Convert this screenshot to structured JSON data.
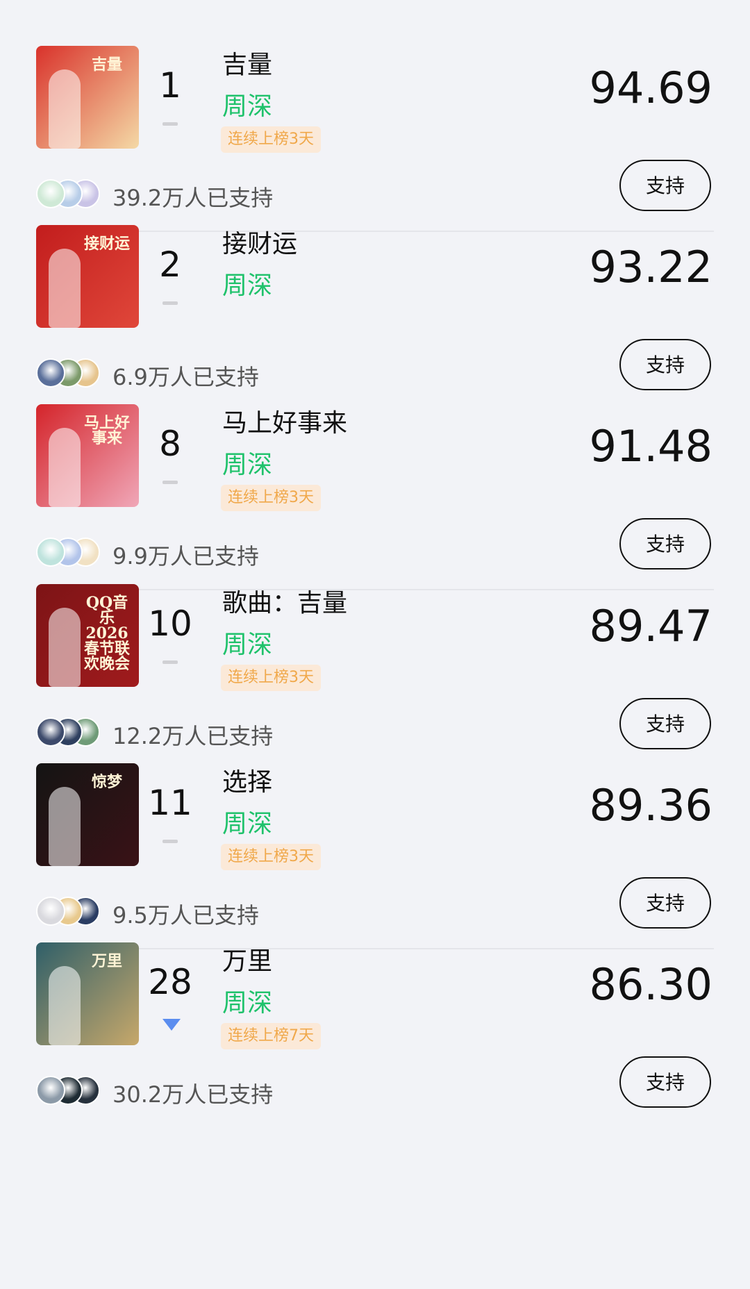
{
  "support_label": "支持",
  "entries": [
    {
      "rank": "1",
      "title": "吉量",
      "artist": "周深",
      "streak": "连续上榜3天",
      "score": "94.69",
      "supporters": "39.2万人已支持",
      "trend": "flat",
      "cover_text": "吉量",
      "cover_colors": [
        "#d9322b",
        "#f4d9a6"
      ],
      "avatar_colors": [
        "#cfe9d6",
        "#b7cde8",
        "#c9c3e6"
      ]
    },
    {
      "rank": "2",
      "title": "接财运",
      "artist": "周深",
      "streak": "",
      "score": "93.22",
      "supporters": "6.9万人已支持",
      "trend": "flat",
      "cover_text": "接财运",
      "cover_colors": [
        "#c21d1d",
        "#e0473a"
      ],
      "avatar_colors": [
        "#5a6f9a",
        "#7c9a6a",
        "#e6c48d"
      ]
    },
    {
      "rank": "8",
      "title": "马上好事来",
      "artist": "周深",
      "streak": "连续上榜3天",
      "score": "91.48",
      "supporters": "9.9万人已支持",
      "trend": "flat",
      "cover_text": "马上好事来",
      "cover_colors": [
        "#d4242a",
        "#f0a7b8"
      ],
      "avatar_colors": [
        "#bfe3dd",
        "#b2c4ea",
        "#f1e1c3"
      ]
    },
    {
      "rank": "10",
      "title": "歌曲：吉量",
      "artist": "周深",
      "streak": "连续上榜3天",
      "score": "89.47",
      "supporters": "12.2万人已支持",
      "trend": "flat",
      "cover_text": "QQ音乐 2026 春节联欢晚会",
      "cover_colors": [
        "#7d1416",
        "#a01b1d"
      ],
      "avatar_colors": [
        "#3d4a6b",
        "#2e3f5f",
        "#6f9b77"
      ]
    },
    {
      "rank": "11",
      "title": "选择",
      "artist": "周深",
      "streak": "连续上榜3天",
      "score": "89.36",
      "supporters": "9.5万人已支持",
      "trend": "flat",
      "cover_text": "惊梦",
      "cover_colors": [
        "#141414",
        "#3a1216"
      ],
      "avatar_colors": [
        "#d9d9de",
        "#e8c98d",
        "#2b3d63"
      ]
    },
    {
      "rank": "28",
      "title": "万里",
      "artist": "周深",
      "streak": "连续上榜7天",
      "score": "86.30",
      "supporters": "30.2万人已支持",
      "trend": "down",
      "cover_text": "万里",
      "cover_colors": [
        "#2f5f69",
        "#c7a86a"
      ],
      "avatar_colors": [
        "#8c9aa8",
        "#1e2b33",
        "#27313d"
      ]
    }
  ]
}
